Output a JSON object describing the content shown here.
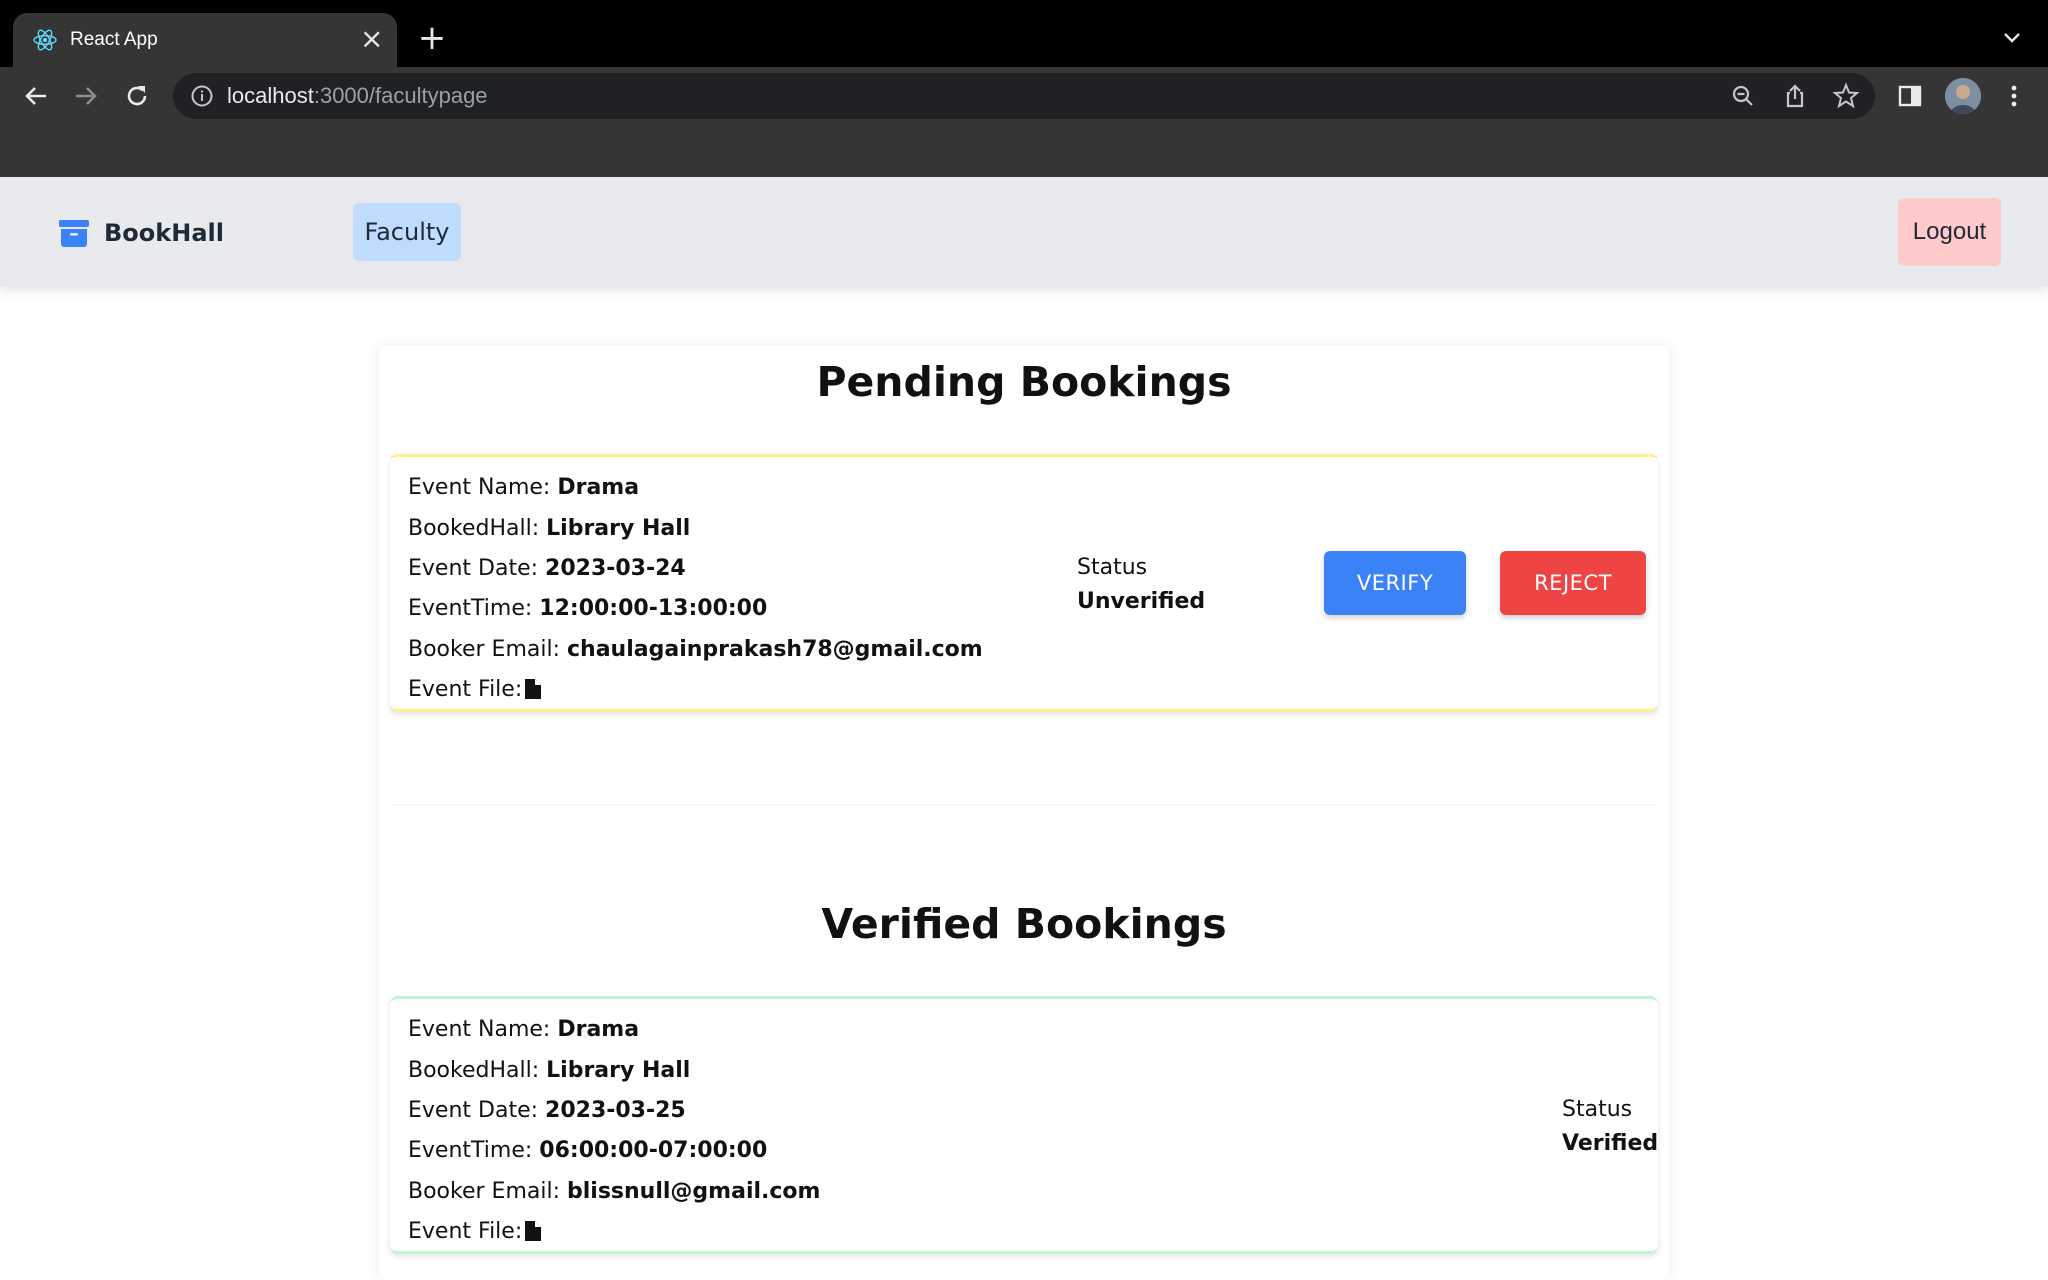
{
  "browser": {
    "tab_title": "React App",
    "url_host": "localhost",
    "url_path": ":3000/facultypage"
  },
  "navbar": {
    "brand": "BookHall",
    "faculty_link": "Faculty",
    "logout": "Logout"
  },
  "pending": {
    "title": "Pending Bookings",
    "bookings": [
      {
        "event_name_label": "Event Name:",
        "event_name": "Drama",
        "hall_label": "BookedHall:",
        "hall": "Library Hall",
        "date_label": "Event Date:",
        "date": "2023-03-24",
        "time_label": "EventTime:",
        "time": "12:00:00-13:00:00",
        "email_label": "Booker Email:",
        "email": "chaulagainprakash78@gmail.com",
        "file_label": "Event File:",
        "status_label": "Status",
        "status": "Unverified",
        "verify_label": "VERIFY",
        "reject_label": "REJECT"
      }
    ]
  },
  "verified": {
    "title": "Verified Bookings",
    "bookings": [
      {
        "event_name_label": "Event Name:",
        "event_name": "Drama",
        "hall_label": "BookedHall:",
        "hall": "Library Hall",
        "date_label": "Event Date:",
        "date": "2023-03-25",
        "time_label": "EventTime:",
        "time": "06:00:00-07:00:00",
        "email_label": "Booker Email:",
        "email": "blissnull@gmail.com",
        "file_label": "Event File:",
        "status_label": "Status",
        "status": "Verified"
      }
    ]
  },
  "colors": {
    "verify": "#3b82f6",
    "reject": "#ef4444",
    "pending_border": "#fef08a",
    "verified_border": "#bbf7d0",
    "faculty_bg": "#bfdbfe",
    "logout_bg": "#fecaca",
    "brand_icon": "#3b82f6"
  },
  "icons": {
    "tab_favicon": "react-icon",
    "brand": "archive-box-icon",
    "event_file": "document-icon"
  }
}
